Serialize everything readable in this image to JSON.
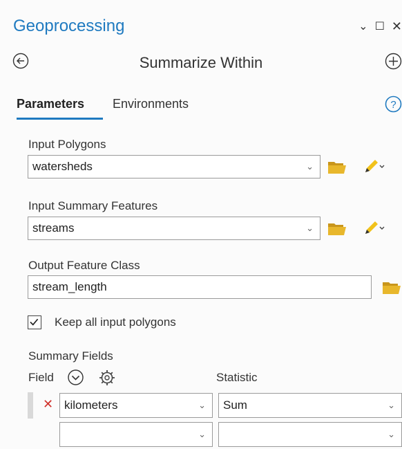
{
  "pane": {
    "title": "Geoprocessing",
    "window_controls": [
      "⌄",
      "☐",
      "✕"
    ]
  },
  "tool": {
    "name": "Summarize Within"
  },
  "tabs": [
    {
      "label": "Parameters",
      "active": true
    },
    {
      "label": "Environments",
      "active": false
    }
  ],
  "params": {
    "input_polygons": {
      "label": "Input Polygons",
      "value": "watersheds"
    },
    "input_summary_features": {
      "label": "Input Summary Features",
      "value": "streams"
    },
    "output_feature_class": {
      "label": "Output Feature Class",
      "value": "stream_length"
    },
    "keep_all": {
      "label": "Keep all input polygons",
      "checked": true
    },
    "summary_fields": {
      "label": "Summary Fields",
      "field_header": "Field",
      "statistic_header": "Statistic",
      "rows": [
        {
          "field": "kilometers",
          "statistic": "Sum"
        },
        {
          "field": "",
          "statistic": ""
        }
      ]
    }
  },
  "colors": {
    "accent": "#1f7ac0",
    "folder": "#e8b72c",
    "pencil": "#f1c21b",
    "delete": "#d0302a"
  }
}
